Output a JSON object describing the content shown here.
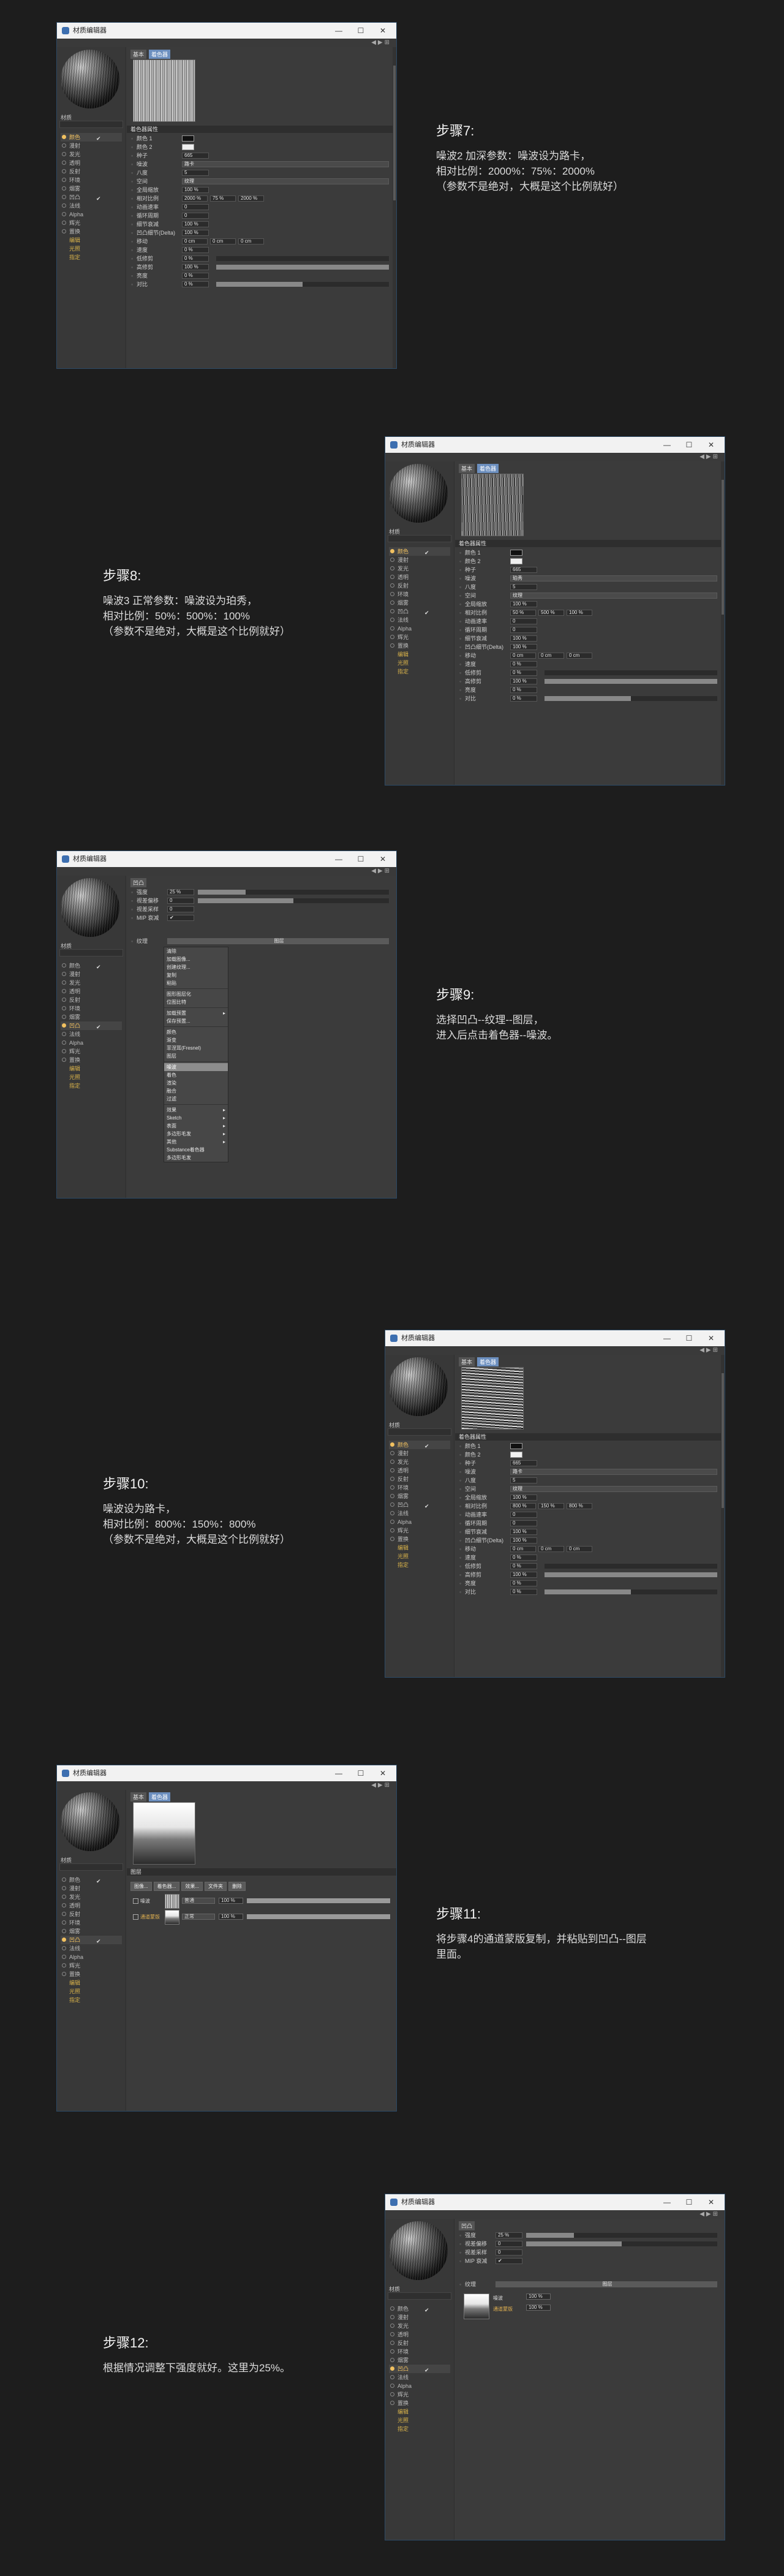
{
  "window": {
    "title": "材质编辑器",
    "btn_min": "—",
    "btn_max": "☐",
    "btn_close": "✕",
    "nav_icons": "◀▶⊞",
    "material_name": "材质"
  },
  "channels": [
    "颜色",
    "漫射",
    "发光",
    "透明",
    "反射",
    "环境",
    "烟雾",
    "凹凸",
    "法线",
    "Alpha",
    "辉光",
    "置换",
    "编辑",
    "光照",
    "指定"
  ],
  "steps": [
    {
      "title": "步骤7:",
      "lines": [
        "噪波2 加深参数：噪波设为路卡，",
        "相对比例：2000%：75%：2000%",
        "（参数不是绝对，大概是这个比例就好）"
      ]
    },
    {
      "title": "步骤8:",
      "lines": [
        "噪波3 正常参数：噪波设为珀秀，",
        "相对比例：50%：500%：100%",
        "（参数不是绝对，大概是这个比例就好）"
      ]
    },
    {
      "title": "步骤9:",
      "lines": [
        "选择凹凸--纹理--图层，",
        "进入后点击着色器--噪波。"
      ]
    },
    {
      "title": "步骤10:",
      "lines": [
        "噪波设为路卡，",
        "相对比例：800%：150%：800%",
        "（参数不是绝对，大概是这个比例就好）"
      ]
    },
    {
      "title": "步骤11:",
      "lines": [
        "将步骤4的通道蒙版复制，并粘贴到凹凸--图层",
        "里面。"
      ]
    },
    {
      "title": "步骤12:",
      "lines": [
        "根据情况调整下强度就好。这里为25%。"
      ]
    }
  ],
  "noise_panel": {
    "tabs": [
      "基本",
      "着色器"
    ],
    "section": "着色器属性",
    "rows": [
      {
        "label": "颜色 1",
        "kind": "swatch",
        "color": "#111111"
      },
      {
        "label": "颜色 2",
        "kind": "swatch",
        "color": "#f0f0f0"
      },
      {
        "label": "种子",
        "kind": "value",
        "value": "665"
      },
      {
        "label": "噪波",
        "kind": "dropdown",
        "value": "路卡"
      },
      {
        "label": "八度",
        "kind": "value",
        "value": "5"
      },
      {
        "label": "空间",
        "kind": "dropdown",
        "value": "纹理"
      },
      {
        "label": "全局缩放",
        "kind": "value",
        "value": "100 %"
      },
      {
        "label": "相对比例",
        "kind": "triple",
        "values": [
          "2000 %",
          "75 %",
          "2000 %"
        ]
      },
      {
        "label": "动画速率",
        "kind": "value",
        "value": "0"
      },
      {
        "label": "循环周期",
        "kind": "value",
        "value": "0"
      },
      {
        "label": "细节衰减",
        "kind": "value",
        "value": "100 %"
      },
      {
        "label": "凹凸细节(Delta)",
        "kind": "value",
        "value": "100 %"
      },
      {
        "label": "移动",
        "kind": "triple",
        "values": [
          "0 cm",
          "0 cm",
          "0 cm"
        ]
      },
      {
        "label": "速度",
        "kind": "value",
        "value": "0 %"
      },
      {
        "label": "低修剪",
        "kind": "bar",
        "value": "0 %",
        "fill": 0
      },
      {
        "label": "高修剪",
        "kind": "bar",
        "value": "100 %",
        "fill": 1
      },
      {
        "label": "亮度",
        "kind": "value",
        "value": "0 %"
      },
      {
        "label": "对比",
        "kind": "bar",
        "value": "0 %",
        "fill": 0.5
      }
    ]
  },
  "step8_overrides": {
    "noise": "珀秀",
    "scale": [
      "50 %",
      "500 %",
      "100 %"
    ]
  },
  "step10_overrides": {
    "noise": "路卡",
    "scale": [
      "800 %",
      "150 %",
      "800 %"
    ]
  },
  "bump_panel": {
    "tab": "凹凸",
    "rows": [
      {
        "label": "强度",
        "value": "25 %",
        "fill": 0.25
      },
      {
        "label": "视差偏移",
        "value": "0",
        "fill": 0.5
      },
      {
        "label": "视差采样",
        "value": "0"
      },
      {
        "label": "MIP 衰减",
        "value": "✔"
      }
    ],
    "texture_label": "纹理",
    "texture_value": "图层"
  },
  "shader_menu": {
    "items": [
      {
        "label": "清除",
        "hl": false
      },
      {
        "label": "加载图像...",
        "hl": false
      },
      {
        "label": "创建纹理...",
        "hl": false
      },
      {
        "label": "复制",
        "hl": false
      },
      {
        "label": "粘贴",
        "hl": false
      },
      {
        "sep": true
      },
      {
        "label": "图形图层化",
        "hl": false
      },
      {
        "label": "位图比特",
        "hl": false
      },
      {
        "sep": true
      },
      {
        "label": "加载预置",
        "hl": false,
        "arrow": "▸"
      },
      {
        "label": "保存预置...",
        "hl": false
      },
      {
        "sep": true
      },
      {
        "label": "颜色",
        "hl": false
      },
      {
        "label": "渐变",
        "hl": false
      },
      {
        "label": "菲涅耳(Fresnel)",
        "hl": false
      },
      {
        "label": "图层",
        "hl": false
      },
      {
        "sep": true
      },
      {
        "label": "噪波",
        "hl": true
      },
      {
        "label": "着色",
        "hl": false
      },
      {
        "label": "渲染",
        "hl": false
      },
      {
        "label": "融合",
        "hl": false
      },
      {
        "label": "过滤",
        "hl": false
      },
      {
        "sep": true
      },
      {
        "label": "效果",
        "hl": false,
        "arrow": "▸"
      },
      {
        "label": "Sketch",
        "hl": false,
        "arrow": "▸"
      },
      {
        "label": "表面",
        "hl": false,
        "arrow": "▸"
      },
      {
        "label": "多边形毛发",
        "hl": false,
        "arrow": "▸"
      },
      {
        "label": "其他",
        "hl": false,
        "arrow": "▸"
      },
      {
        "label": "Substance着色器",
        "hl": false
      },
      {
        "label": "多边形毛发",
        "hl": false
      }
    ]
  },
  "layer_panel": {
    "section": "图层",
    "tools": [
      "图像...",
      "着色器...",
      "效果...",
      "文件夹",
      "删除"
    ],
    "layers": [
      {
        "name": "噪波",
        "mode": "普通",
        "pct": "100 %"
      },
      {
        "name": "通道蒙版",
        "mode": "正常",
        "pct": "100 %"
      }
    ]
  }
}
